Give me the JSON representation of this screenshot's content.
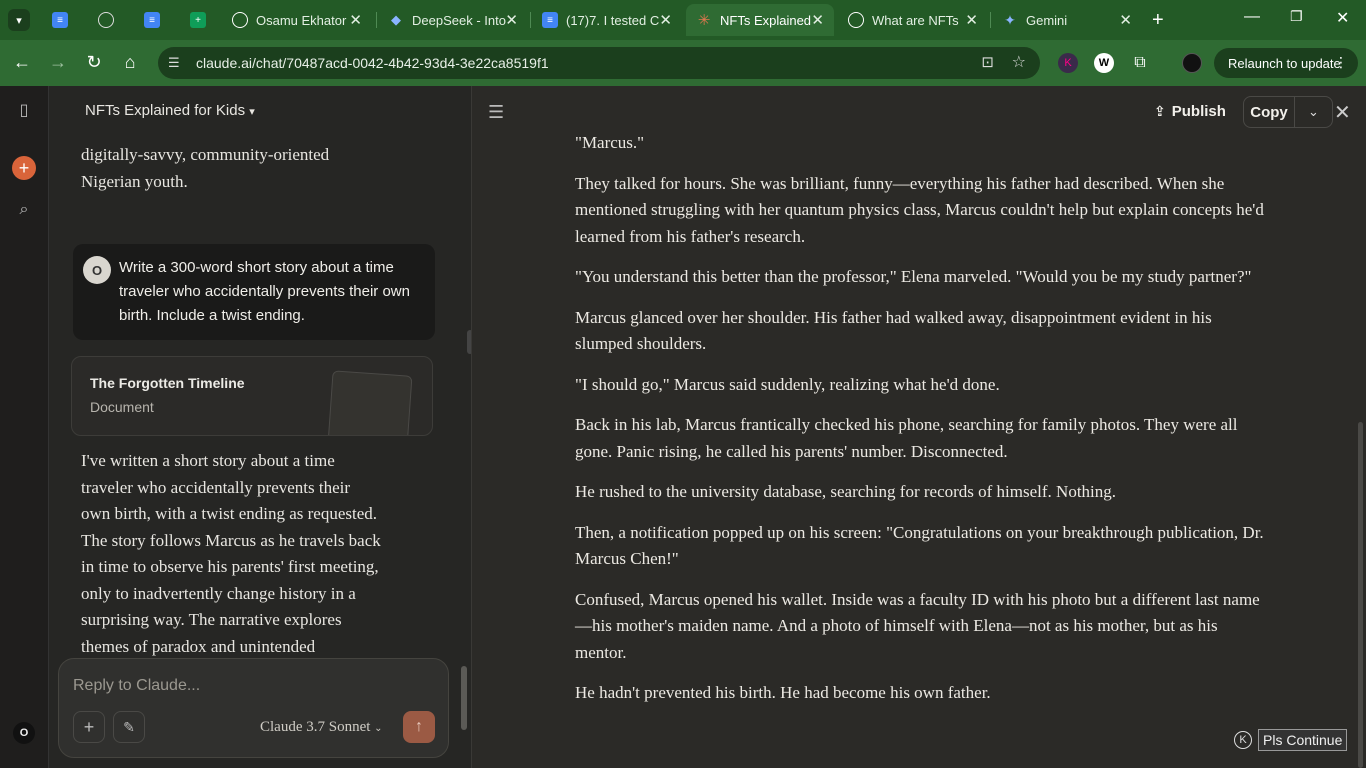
{
  "browser": {
    "tabs": [
      {
        "label": "",
        "icon": "docs-icon"
      },
      {
        "label": "",
        "icon": "globe-icon"
      },
      {
        "label": "",
        "icon": "docs-icon"
      },
      {
        "label": "",
        "icon": "sheets-icon"
      },
      {
        "label": "Osamu Ekhator",
        "icon": "chatgpt-icon"
      },
      {
        "label": "DeepSeek - Into",
        "icon": "deepseek-icon"
      },
      {
        "label": "(17)7. I tested C",
        "icon": "docs-icon"
      },
      {
        "label": "NFTs Explained",
        "icon": "claude-icon"
      },
      {
        "label": "What are NFTs",
        "icon": "chatgpt-icon"
      },
      {
        "label": "Gemini",
        "icon": "gemini-icon"
      }
    ],
    "url": "claude.ai/chat/70487acd-0042-4b42-93d4-3e22ca8519f1",
    "relaunch_label": "Relaunch to update",
    "ext_k": "K",
    "ext_w": "W"
  },
  "sidebar": {
    "user_initial": "O"
  },
  "chat": {
    "title": "NFTs Explained for Kids",
    "prev_text": [
      "digitally-savvy, community-oriented",
      "Nigerian youth."
    ],
    "user_initial": "O",
    "user_message": "Write a 300-word short story about a time traveler who accidentally prevents their own birth. Include a twist ending.",
    "doc_title": "The Forgotten Timeline",
    "doc_type": "Document",
    "reply_lines": [
      "I've written a short story about a time",
      "traveler who accidentally prevents their",
      "own birth, with a twist ending as requested.",
      "The story follows Marcus as he travels back",
      "in time to observe his parents' first meeting,",
      "only to inadvertently change history in a",
      "surprising way. The narrative explores",
      "themes of paradox and unintended"
    ],
    "input_placeholder": "Reply to Claude...",
    "model": "Claude 3.7 Sonnet"
  },
  "artifact": {
    "publish_label": "Publish",
    "copy_label": "Copy",
    "paragraphs": [
      "\"Marcus.\"",
      "They talked for hours. She was brilliant, funny—everything his father had described. When she mentioned struggling with her quantum physics class, Marcus couldn't help but explain concepts he'd learned from his father's research.",
      "\"You understand this better than the professor,\" Elena marveled. \"Would you be my study partner?\"",
      "Marcus glanced over her shoulder. His father had walked away, disappointment evident in his slumped shoulders.",
      "\"I should go,\" Marcus said suddenly, realizing what he'd done.",
      "Back in his lab, Marcus frantically checked his phone, searching for family photos. They were all gone. Panic rising, he called his parents' number. Disconnected.",
      "He rushed to the university database, searching for records of himself. Nothing.",
      "Then, a notification popped up on his screen: \"Congratulations on your breakthrough publication, Dr. Marcus Chen!\"",
      "Confused, Marcus opened his wallet. Inside was a faculty ID with his photo but a different last name—his mother's maiden name. And a photo of himself with Elena—not as his mother, but as his mentor.",
      "He hadn't prevented his birth. He had become his own father."
    ],
    "pls_continue": "Pls Continue",
    "k_badge": "K"
  }
}
